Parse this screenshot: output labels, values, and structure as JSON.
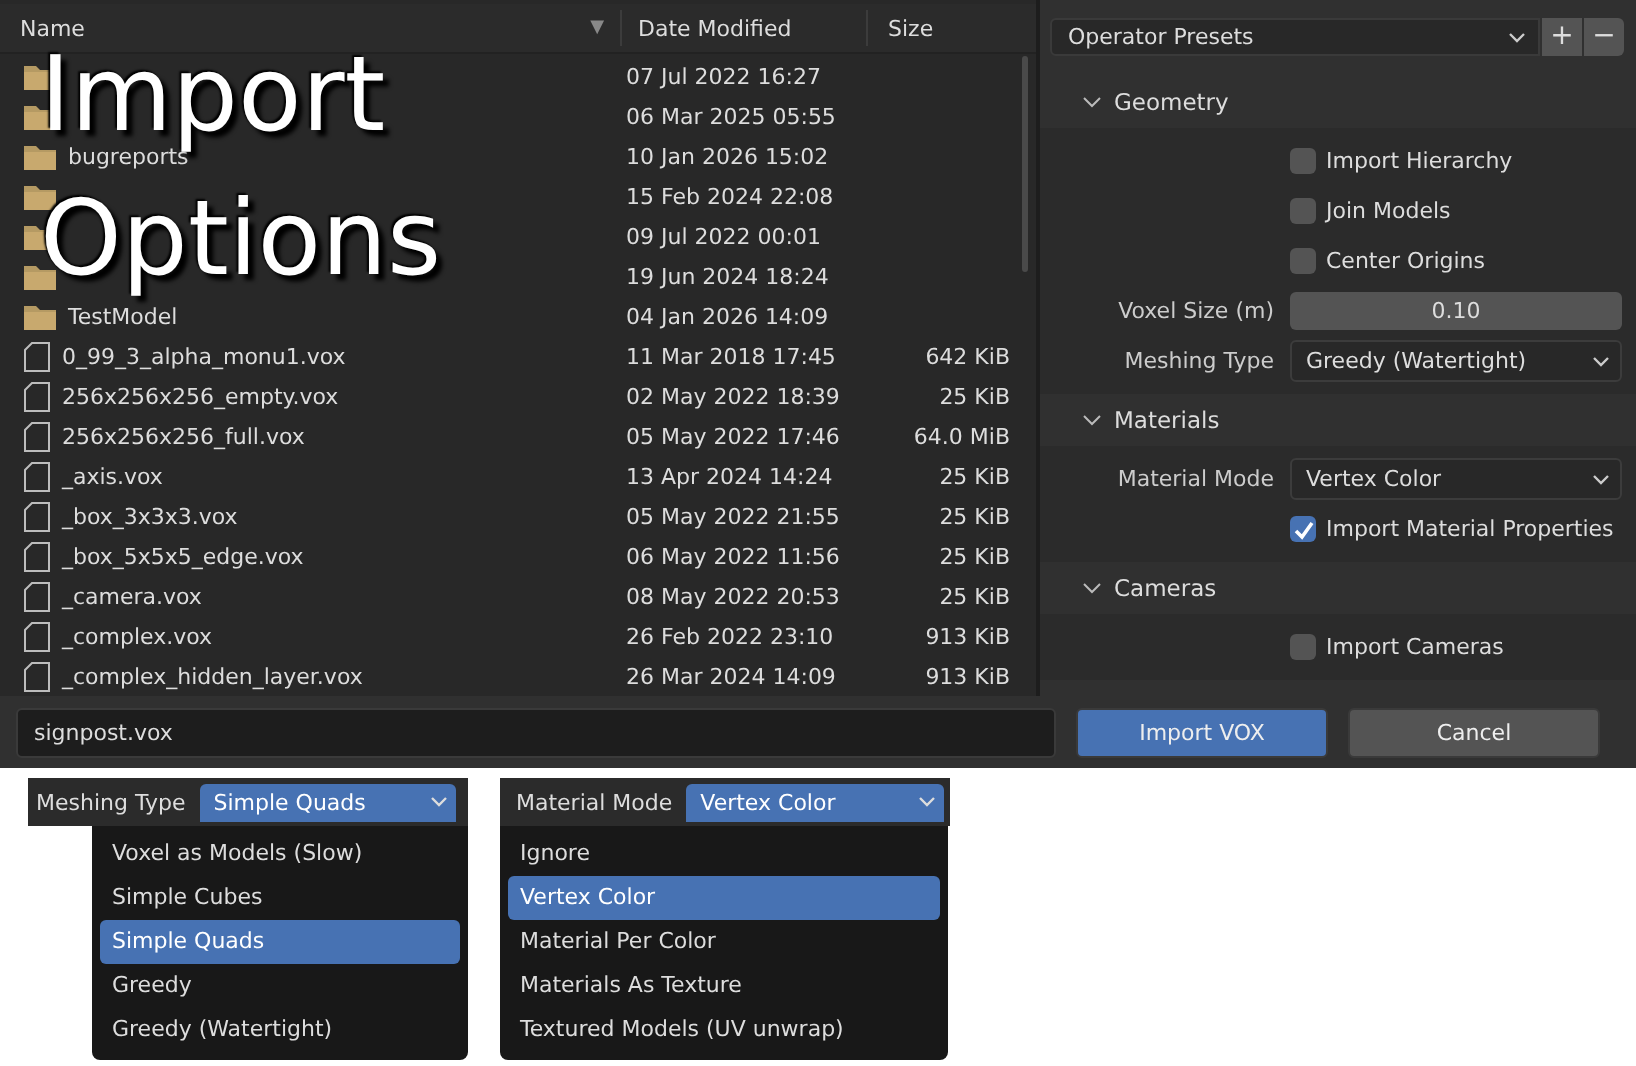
{
  "file_browser": {
    "columns": [
      {
        "label": "Name",
        "sort_indicator": "▼"
      },
      {
        "label": "Date Modified"
      },
      {
        "label": "Size"
      }
    ],
    "rows": [
      {
        "kind": "folder",
        "date": "07 Jul 2022 16:27"
      },
      {
        "kind": "folder",
        "date": "06 Mar 2025 05:55"
      },
      {
        "kind": "folder",
        "name": "bugreports",
        "date": "10 Jan 2026 15:02"
      },
      {
        "kind": "folder",
        "date": "15 Feb 2024 22:08"
      },
      {
        "kind": "folder",
        "date": "09 Jul 2022 00:01"
      },
      {
        "kind": "folder",
        "date": "19 Jun 2024 18:24"
      },
      {
        "kind": "folder",
        "name": "TestModel",
        "date": "04 Jan 2026 14:09"
      },
      {
        "kind": "file",
        "name": "0_99_3_alpha_monu1.vox",
        "date": "11 Mar 2018 17:45",
        "size": "642 KiB"
      },
      {
        "kind": "file",
        "name": "256x256x256_empty.vox",
        "date": "02 May 2022 18:39",
        "size": "25 KiB"
      },
      {
        "kind": "file",
        "name": "256x256x256_full.vox",
        "date": "05 May 2022 17:46",
        "size": "64.0 MiB"
      },
      {
        "kind": "file",
        "name": "_axis.vox",
        "date": "13 Apr 2024 14:24",
        "size": "25 KiB"
      },
      {
        "kind": "file",
        "name": "_box_3x3x3.vox",
        "date": "05 May 2022 21:55",
        "size": "25 KiB"
      },
      {
        "kind": "file",
        "name": "_box_5x5x5_edge.vox",
        "date": "06 May 2022 11:56",
        "size": "25 KiB"
      },
      {
        "kind": "file",
        "name": "_camera.vox",
        "date": "08 May 2022 20:53",
        "size": "25 KiB"
      },
      {
        "kind": "file",
        "name": "_complex.vox",
        "date": "26 Feb 2022 23:10",
        "size": "913 KiB"
      },
      {
        "kind": "file",
        "name": "_complex_hidden_layer.vox",
        "date": "26 Mar 2024 14:09",
        "size": "913 KiB"
      }
    ]
  },
  "overlay_title": [
    "Import",
    "Options"
  ],
  "presets": {
    "value": "Operator Presets",
    "buttons": [
      "+",
      "−"
    ]
  },
  "sections": [
    {
      "title": "Geometry",
      "expanded": true,
      "items": [
        {
          "kind": "checkbox",
          "label": "Import Hierarchy",
          "checked": false
        },
        {
          "kind": "checkbox",
          "label": "Join Models",
          "checked": false
        },
        {
          "kind": "checkbox",
          "label": "Center Origins",
          "checked": false
        },
        {
          "kind": "number",
          "label": "Voxel Size (m)",
          "value": "0.10"
        },
        {
          "kind": "dropdown",
          "label": "Meshing Type",
          "value": "Greedy (Watertight)"
        }
      ]
    },
    {
      "title": "Materials",
      "expanded": true,
      "items": [
        {
          "kind": "dropdown",
          "label": "Material Mode",
          "value": "Vertex Color"
        },
        {
          "kind": "checkbox",
          "label": "Import Material Properties",
          "checked": true
        }
      ]
    },
    {
      "title": "Cameras",
      "expanded": true,
      "items": [
        {
          "kind": "checkbox",
          "label": "Import Cameras",
          "checked": false
        }
      ]
    }
  ],
  "filename": "signpost.vox",
  "buttons": [
    {
      "label": "Import VOX",
      "kind": "primary"
    },
    {
      "label": "Cancel",
      "kind": "secondary"
    }
  ],
  "popups": [
    {
      "label": "Meshing Type",
      "value": "Simple Quads",
      "options": [
        {
          "label": "Voxel as Models (Slow)",
          "selected": false
        },
        {
          "label": "Simple Cubes",
          "selected": false
        },
        {
          "label": "Simple Quads",
          "selected": true
        },
        {
          "label": "Greedy",
          "selected": false
        },
        {
          "label": "Greedy (Watertight)",
          "selected": false
        }
      ]
    },
    {
      "label": "Material Mode",
      "value": "Vertex Color",
      "options": [
        {
          "label": "Ignore",
          "selected": false
        },
        {
          "label": "Vertex Color",
          "selected": true
        },
        {
          "label": "Material Per Color",
          "selected": false
        },
        {
          "label": "Materials As Texture",
          "selected": false
        },
        {
          "label": "Textured Models (UV unwrap)",
          "selected": false
        }
      ]
    }
  ]
}
